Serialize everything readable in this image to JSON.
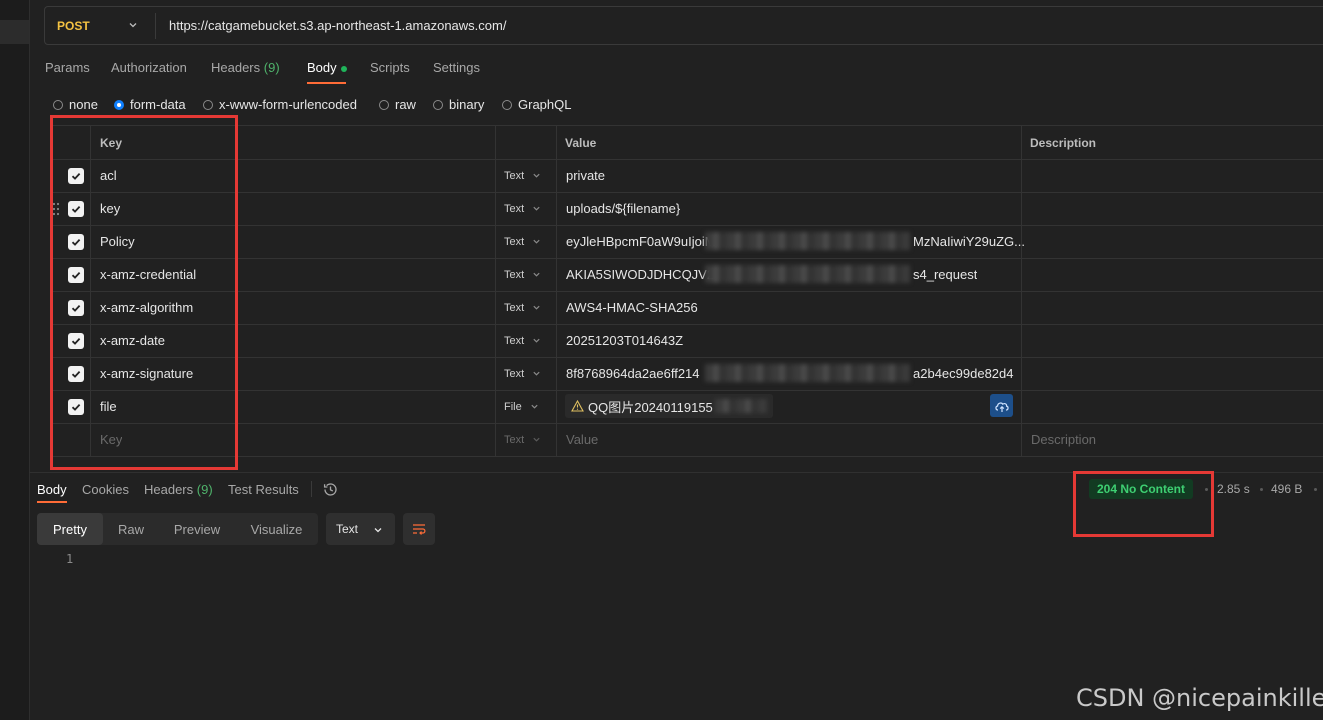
{
  "request": {
    "method": "POST",
    "url": "https://catgamebucket.s3.ap-northeast-1.amazonaws.com/"
  },
  "request_tabs": [
    {
      "label": "Params"
    },
    {
      "label": "Authorization"
    },
    {
      "label": "Headers",
      "count": "(9)"
    },
    {
      "label": "Body"
    },
    {
      "label": "Scripts"
    },
    {
      "label": "Settings"
    }
  ],
  "body_modes": [
    "none",
    "form-data",
    "x-www-form-urlencoded",
    "raw",
    "binary",
    "GraphQL"
  ],
  "selected_body_mode": "form-data",
  "table": {
    "headers": {
      "key": "Key",
      "value": "Value",
      "description": "Description"
    },
    "rows": [
      {
        "key": "acl",
        "type": "Text",
        "value": "private"
      },
      {
        "key": "key",
        "type": "Text",
        "value": "uploads/${filename}"
      },
      {
        "key": "Policy",
        "type": "Text",
        "value": "eyJleHBpcmF0aW9uIjoiM",
        "value_tail": "MzNaIiwiY29uZG..."
      },
      {
        "key": "x-amz-credential",
        "type": "Text",
        "value": "AKIA5SIWODJDHCQJV2",
        "value_tail": "s4_request"
      },
      {
        "key": "x-amz-algorithm",
        "type": "Text",
        "value": "AWS4-HMAC-SHA256"
      },
      {
        "key": "x-amz-date",
        "type": "Text",
        "value": "20251203T014643Z"
      },
      {
        "key": "x-amz-signature",
        "type": "Text",
        "value": "8f8768964da2ae6ff214",
        "value_tail": "a2b4ec99de82d4"
      },
      {
        "key": "file",
        "type": "File",
        "value": "QQ图片20240119155"
      }
    ],
    "placeholder": {
      "key": "Key",
      "type": "Text",
      "value": "Value",
      "description": "Description"
    }
  },
  "response": {
    "tabs": [
      {
        "label": "Body"
      },
      {
        "label": "Cookies"
      },
      {
        "label": "Headers",
        "count": "(9)"
      },
      {
        "label": "Test Results"
      }
    ],
    "status": "204 No Content",
    "time": "2.85 s",
    "size": "496 B",
    "views": [
      "Pretty",
      "Raw",
      "Preview",
      "Visualize"
    ],
    "format": "Text",
    "line_number": "1"
  },
  "watermark": "CSDN @nicepainkiller",
  "colors": {
    "accent": "#ff6c37",
    "method": "#f4c242",
    "status": "#3ecf72",
    "annotation": "#e53935"
  }
}
